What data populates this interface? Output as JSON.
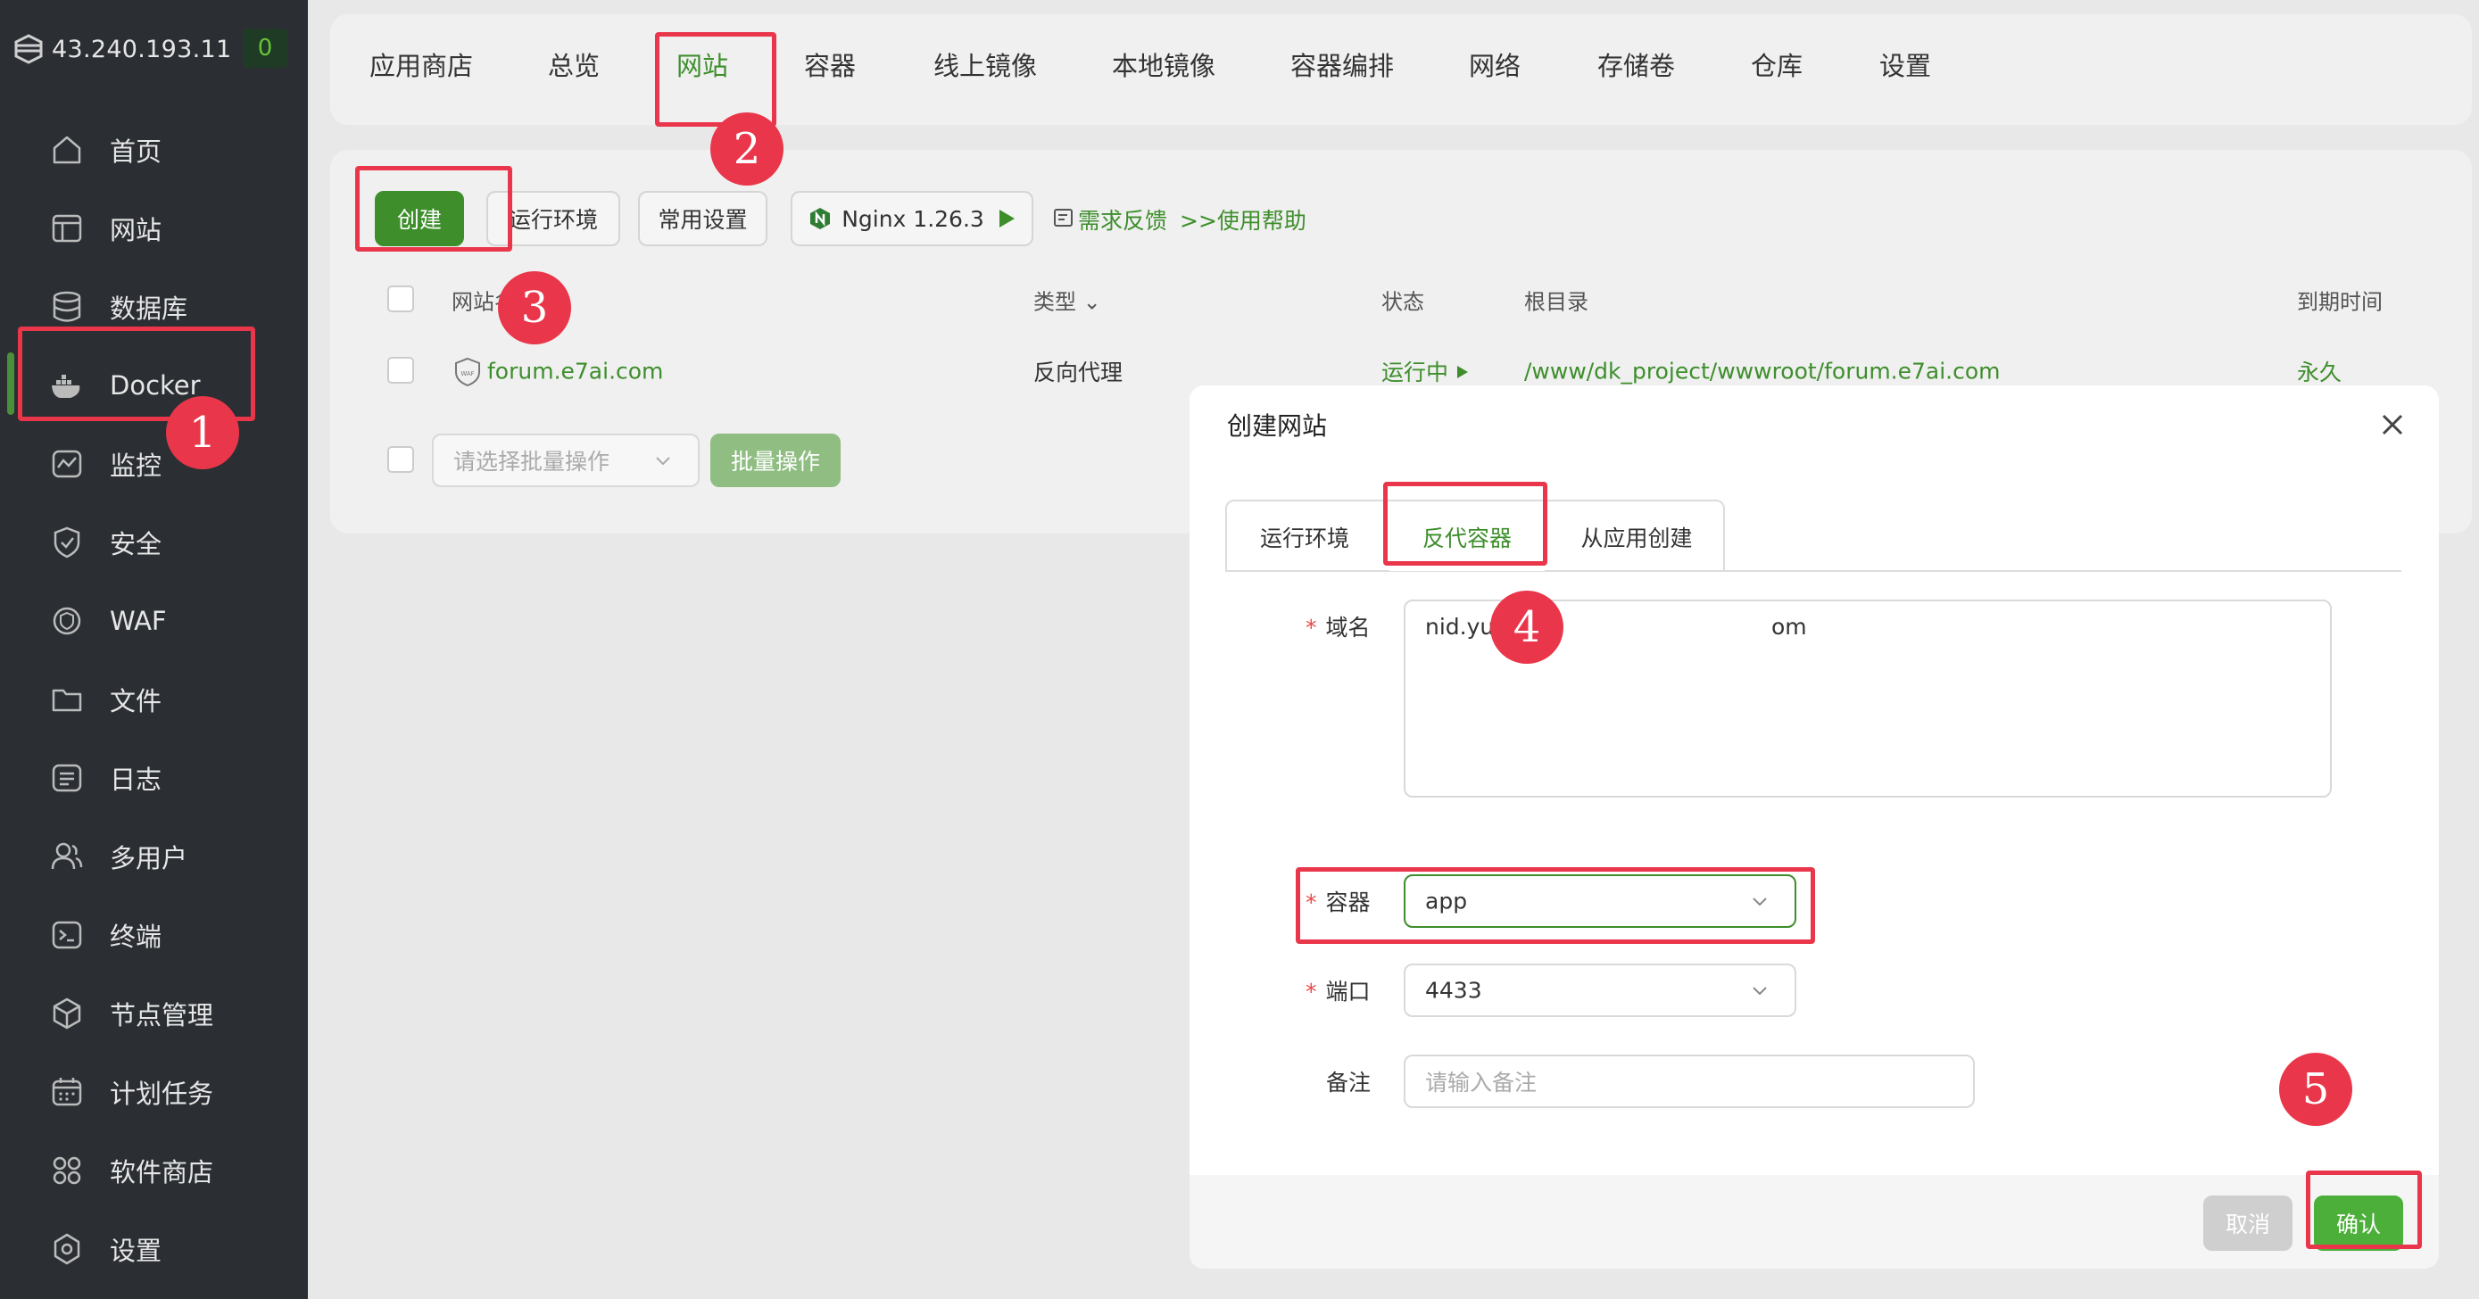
{
  "sidebar": {
    "server_ip": "43.240.193.11",
    "badge": "0",
    "items": [
      {
        "label": "首页",
        "icon": "home-icon"
      },
      {
        "label": "网站",
        "icon": "website-icon"
      },
      {
        "label": "数据库",
        "icon": "database-icon"
      },
      {
        "label": "Docker",
        "icon": "docker-icon"
      },
      {
        "label": "监控",
        "icon": "monitor-icon"
      },
      {
        "label": "安全",
        "icon": "shield-icon"
      },
      {
        "label": "WAF",
        "icon": "waf-icon"
      },
      {
        "label": "文件",
        "icon": "folder-icon"
      },
      {
        "label": "日志",
        "icon": "log-icon"
      },
      {
        "label": "多用户",
        "icon": "users-icon"
      },
      {
        "label": "终端",
        "icon": "terminal-icon"
      },
      {
        "label": "节点管理",
        "icon": "node-icon"
      },
      {
        "label": "计划任务",
        "icon": "calendar-icon"
      },
      {
        "label": "软件商店",
        "icon": "store-icon"
      },
      {
        "label": "设置",
        "icon": "settings-icon"
      }
    ]
  },
  "topbar": {
    "tabs": [
      "应用商店",
      "总览",
      "网站",
      "容器",
      "线上镜像",
      "本地镜像",
      "容器编排",
      "网络",
      "存储卷",
      "仓库",
      "设置"
    ],
    "active": "网站"
  },
  "toolbar": {
    "create": "创建",
    "runtime": "运行环境",
    "common_settings": "常用设置",
    "nginx": "Nginx 1.26.3",
    "feedback": "需求反馈",
    "help": ">>使用帮助"
  },
  "table": {
    "headers": {
      "site": "网站名",
      "type": "类型",
      "status": "状态",
      "root": "根目录",
      "expire": "到期时间"
    },
    "rows": [
      {
        "site": "forum.e7ai.com",
        "type": "反向代理",
        "status": "运行中",
        "root": "/www/dk_project/wwwroot/forum.e7ai.com",
        "expire": "永久"
      }
    ],
    "batch_placeholder": "请选择批量操作",
    "batch_button": "批量操作"
  },
  "dialog": {
    "title": "创建网站",
    "tabs": [
      "运行环境",
      "反代容器",
      "从应用创建"
    ],
    "active_tab": "反代容器",
    "fields": {
      "domain_label": "域名",
      "domain_value": "nid.yui",
      "domain_value_tail": "om",
      "container_label": "容器",
      "container_value": "app",
      "port_label": "端口",
      "port_value": "4433",
      "note_label": "备注",
      "note_placeholder": "请输入备注"
    },
    "cancel": "取消",
    "confirm": "确认"
  },
  "markers": [
    "1",
    "2",
    "3",
    "4",
    "5"
  ],
  "colors": {
    "accent": "#3e8e2c",
    "annotation": "#e9364a",
    "sidebar_bg": "#2b2f34"
  }
}
